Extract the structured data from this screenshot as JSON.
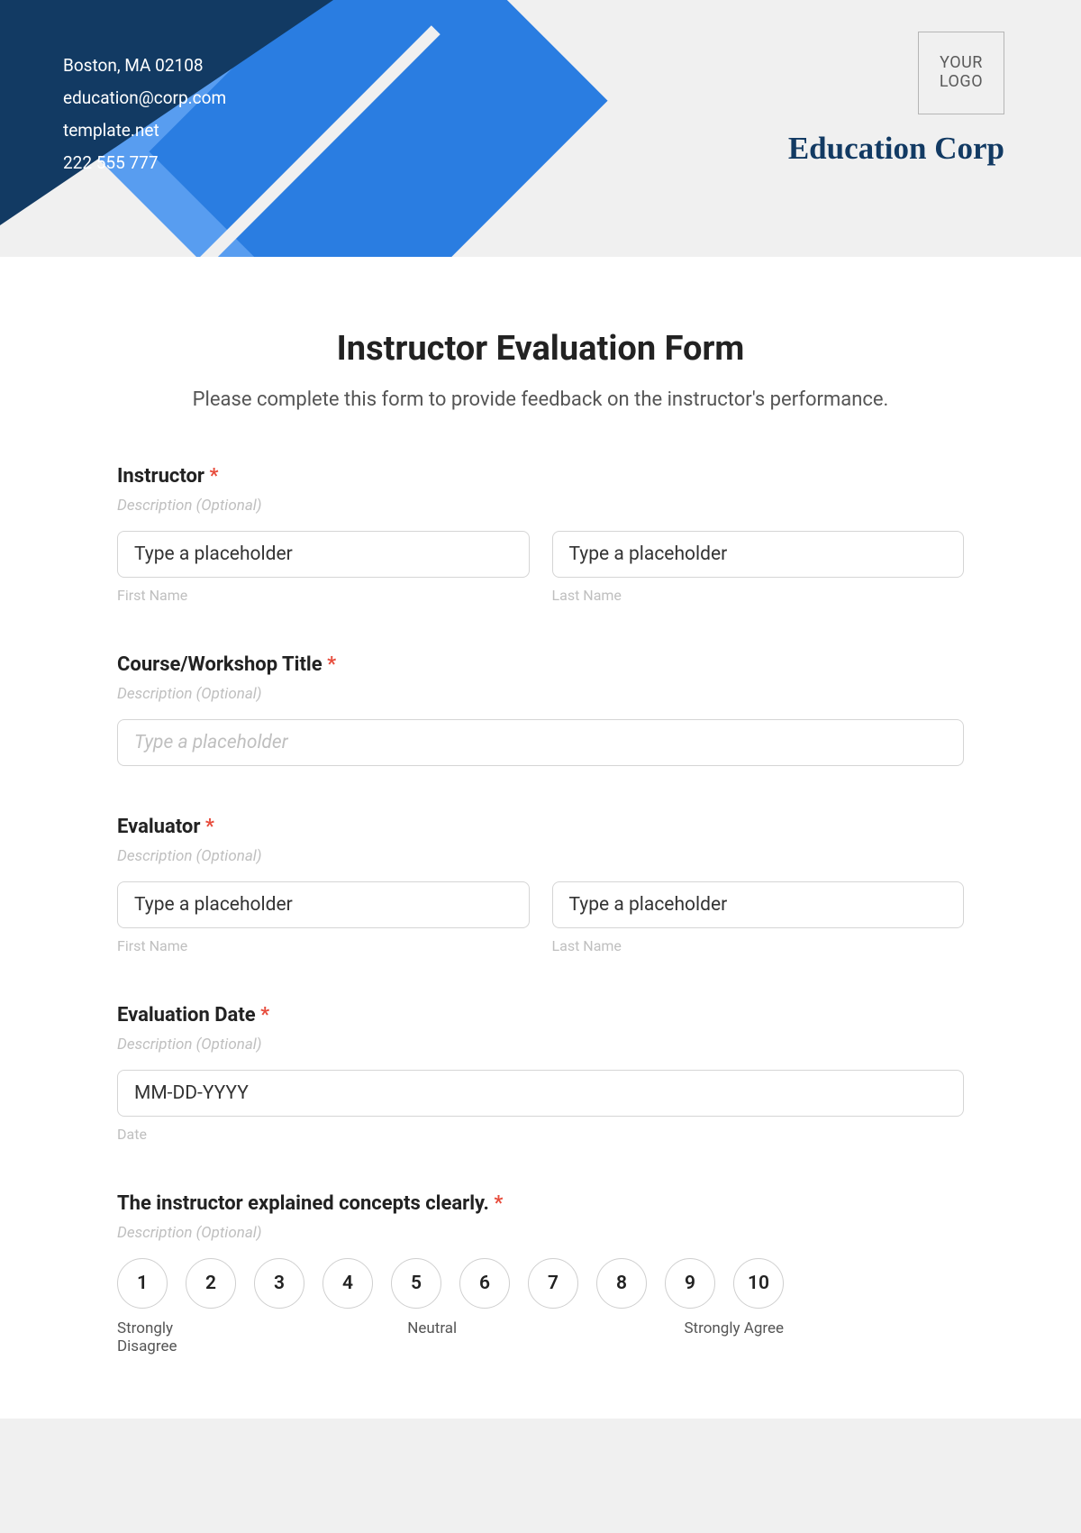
{
  "header": {
    "contact": {
      "line1": "Boston, MA 02108",
      "line2": "education@corp.com",
      "line3": "template.net",
      "line4": "222 555 777"
    },
    "logo_text": "YOUR LOGO",
    "brand": "Education Corp"
  },
  "form": {
    "title": "Instructor Evaluation Form",
    "subtitle": "Please complete this form to provide feedback on the instructor's performance.",
    "desc_placeholder": "Description (Optional)",
    "instructor": {
      "label": "Instructor",
      "first_ph": "Type a placeholder",
      "last_ph": "Type a placeholder",
      "first_sub": "First Name",
      "last_sub": "Last Name"
    },
    "course": {
      "label": "Course/Workshop Title",
      "ph": "Type a placeholder"
    },
    "evaluator": {
      "label": "Evaluator",
      "first_ph": "Type a placeholder",
      "last_ph": "Type a placeholder",
      "first_sub": "First Name",
      "last_sub": "Last Name"
    },
    "date": {
      "label": "Evaluation Date",
      "ph": "MM-DD-YYYY",
      "sub": "Date"
    },
    "q1": {
      "label": "The instructor explained concepts clearly.",
      "scale_low": "Strongly Disagree",
      "scale_mid": "Neutral",
      "scale_high": "Strongly Agree",
      "options": [
        "1",
        "2",
        "3",
        "4",
        "5",
        "6",
        "7",
        "8",
        "9",
        "10"
      ]
    },
    "required_mark": "*"
  }
}
